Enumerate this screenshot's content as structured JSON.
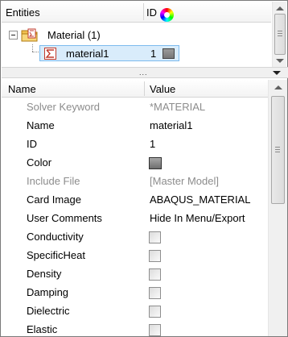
{
  "entities_panel": {
    "header_entities": "Entities",
    "header_id": "ID",
    "color_wheel_icon": "color-wheel-icon",
    "tree": {
      "parent_label": "Material (1)",
      "parent_icon": "material-folder-icon",
      "child_label": "material1",
      "child_icon": "material-icon",
      "child_id": "1",
      "child_color": "#8a8a8a"
    }
  },
  "splitter": {
    "grip": "...",
    "dropdown_icon": "triangle-down-icon"
  },
  "properties": {
    "header_name": "Name",
    "header_value": "Value",
    "rows": [
      {
        "name": "Solver Keyword",
        "value": "*MATERIAL",
        "type": "text",
        "disabled": true
      },
      {
        "name": "Name",
        "value": "material1",
        "type": "text",
        "disabled": false
      },
      {
        "name": "ID",
        "value": "1",
        "type": "text",
        "disabled": false
      },
      {
        "name": "Color",
        "value": "",
        "type": "color",
        "disabled": false
      },
      {
        "name": "Include File",
        "value": "[Master Model]",
        "type": "text",
        "disabled": true
      },
      {
        "name": "Card Image",
        "value": "ABAQUS_MATERIAL",
        "type": "text",
        "disabled": false
      },
      {
        "name": "User Comments",
        "value": "Hide In Menu/Export",
        "type": "text",
        "disabled": false
      },
      {
        "name": "Conductivity",
        "value": "",
        "type": "checkbox",
        "disabled": false
      },
      {
        "name": "SpecificHeat",
        "value": "",
        "type": "checkbox",
        "disabled": false
      },
      {
        "name": "Density",
        "value": "",
        "type": "checkbox",
        "disabled": false
      },
      {
        "name": "Damping",
        "value": "",
        "type": "checkbox",
        "disabled": false
      },
      {
        "name": "Dielectric",
        "value": "",
        "type": "checkbox",
        "disabled": false
      },
      {
        "name": "Elastic",
        "value": "",
        "type": "checkbox",
        "disabled": false
      }
    ]
  },
  "colors": {
    "selection_bg": "#d9ecfb",
    "selection_border": "#7dbbee",
    "disabled_text": "#8c8c8c"
  }
}
